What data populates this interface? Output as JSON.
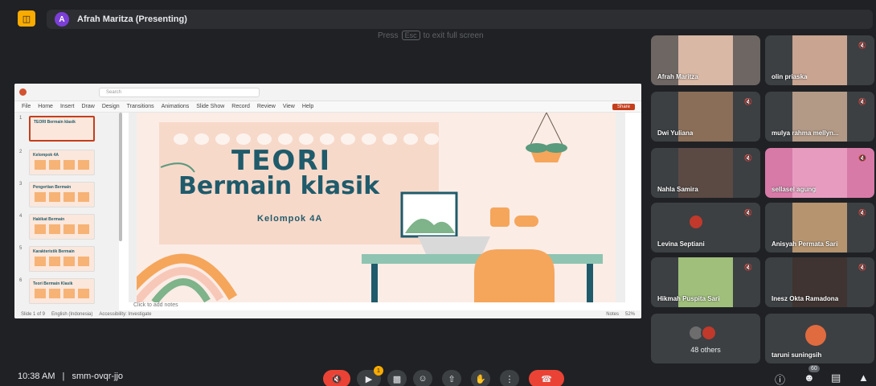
{
  "header": {
    "presenter_initial": "A",
    "presenting_label": "Afrah Maritza (Presenting)",
    "fullscreen_hint_pre": "Press",
    "fullscreen_hint_key": "Esc",
    "fullscreen_hint_post": "to exit full screen"
  },
  "powerpoint": {
    "search_placeholder": "Search",
    "menu": [
      "File",
      "Home",
      "Insert",
      "Draw",
      "Design",
      "Transitions",
      "Animations",
      "Slide Show",
      "Record",
      "Review",
      "View",
      "Help"
    ],
    "share_label": "Share",
    "thumbnails": [
      {
        "num": "1",
        "title": "TEORI Bermain klasik"
      },
      {
        "num": "2",
        "title": "Kelompok 4A"
      },
      {
        "num": "3",
        "title": "Pengertian Bermain"
      },
      {
        "num": "4",
        "title": "Hakikat Bermain"
      },
      {
        "num": "5",
        "title": "Karakteristik Bermain"
      },
      {
        "num": "6",
        "title": "Teori Bermain Klasik"
      }
    ],
    "slide": {
      "title_line1": "TEORI",
      "title_line2": "Bermain klasik",
      "subtitle": "Kelompok 4A"
    },
    "notes_placeholder": "Click to add notes",
    "status": {
      "slide_count": "Slide 1 of 9",
      "language": "English (Indonesia)",
      "accessibility": "Accessibility: Investigate",
      "notes_btn": "Notes",
      "zoom": "52%"
    }
  },
  "participants": [
    {
      "name": "Afrah Maritza",
      "muted": false
    },
    {
      "name": "olin priaska",
      "muted": true
    },
    {
      "name": "Dwi Yuliana",
      "muted": true
    },
    {
      "name": "mulya rahma mellyn...",
      "muted": true
    },
    {
      "name": "Nahla Samira",
      "muted": true
    },
    {
      "name": "sellasel agung",
      "muted": true
    },
    {
      "name": "Levina Septiani",
      "muted": true
    },
    {
      "name": "Anisyah Permata Sari",
      "muted": true
    },
    {
      "name": "Hikmah Puspita Sari",
      "muted": true
    },
    {
      "name": "Inesz Okta Ramadona",
      "muted": true
    },
    {
      "name": "taruni suningsih",
      "muted": false
    }
  ],
  "others_label": "48 others",
  "footer": {
    "time": "10:38 AM",
    "separator": "|",
    "meeting_code": "smm-ovqr-jjo",
    "reactions_badge": "1",
    "people_count": "60"
  },
  "colors": {
    "meet_bg": "#202124",
    "tile_bg": "#3c4043",
    "end_call": "#ea4335",
    "slide_teal": "#1f5b6b",
    "slide_peach": "#fbece6"
  }
}
